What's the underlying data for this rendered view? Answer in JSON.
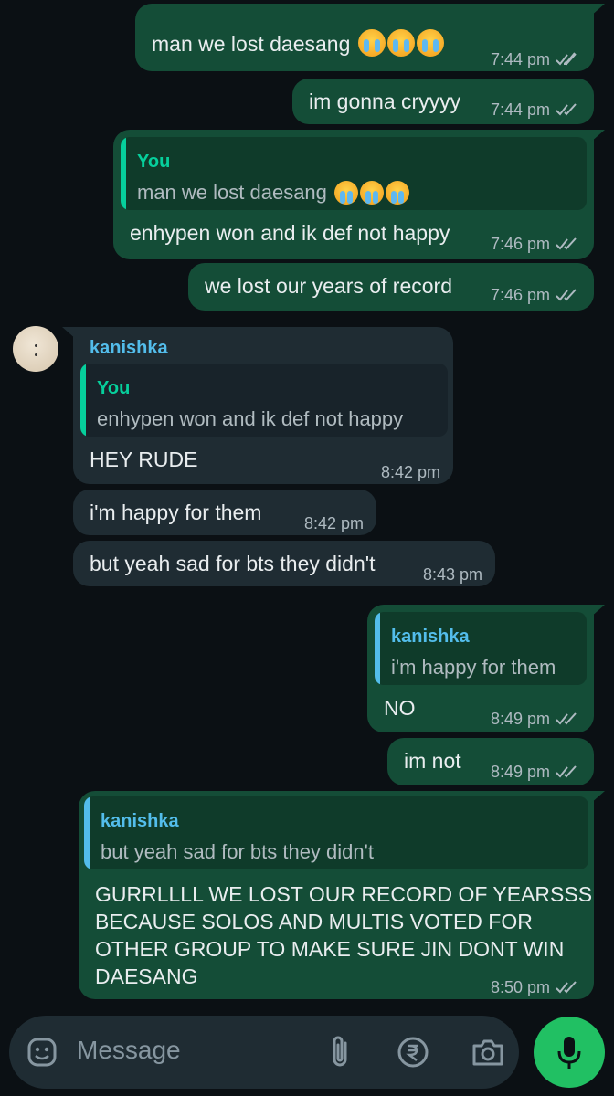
{
  "chat": {
    "messages": [
      {
        "text": "man we lost daesang",
        "time": "7:44 pm"
      },
      {
        "text": "im gonna cryyyy",
        "time": "7:44 pm"
      },
      {
        "quote_name": "You",
        "quote_text": "man we lost daesang",
        "text": "enhypen won and ik def not happy",
        "time": "7:46 pm"
      },
      {
        "text": "we lost our years of record",
        "time": "7:46 pm"
      },
      {
        "sender": "kanishka",
        "quote_name": "You",
        "quote_text": "enhypen won and ik def not happy",
        "text": "HEY RUDE",
        "time": "8:42 pm"
      },
      {
        "text": "i'm happy for them",
        "time": "8:42 pm"
      },
      {
        "text": "but yeah sad for bts they didn't",
        "time": "8:43 pm"
      },
      {
        "quote_name": "kanishka",
        "quote_text": "i'm happy for them",
        "text": "NO",
        "time": "8:49 pm"
      },
      {
        "text": "im not",
        "time": "8:49 pm"
      },
      {
        "quote_name": "kanishka",
        "quote_text": "but yeah sad for bts they didn't",
        "lines": [
          "GURRLLLL WE LOST OUR RECORD OF YEARSSS",
          "BECAUSE SOLOS AND MULTIS VOTED FOR",
          "OTHER GROUP TO MAKE SURE JIN DONT WIN",
          "DAESANG"
        ],
        "time": "8:50 pm"
      }
    ]
  },
  "composer": {
    "placeholder": "Message",
    "icons": [
      "sticker-icon",
      "attach-icon",
      "rupee-payment-icon",
      "camera-icon",
      "mic-icon"
    ]
  },
  "colors": {
    "background": "#0b1014",
    "outgoing": "#144d37",
    "incoming": "#1f2c33",
    "accent_green": "#21c063",
    "quote_you": "#06cf9c",
    "quote_contact": "#53bdeb",
    "read_ticks": "#aebac1"
  }
}
